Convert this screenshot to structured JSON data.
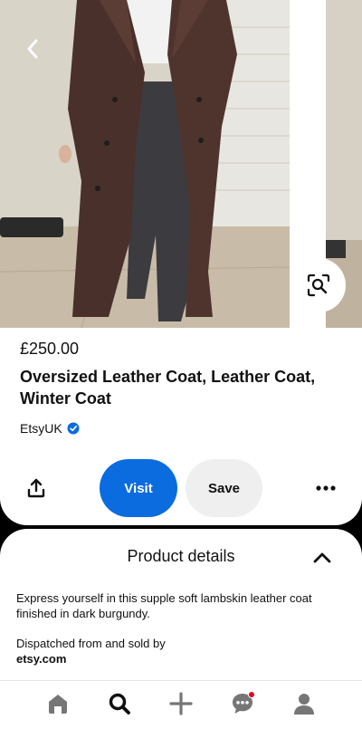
{
  "product": {
    "price": "£250.00",
    "title": "Oversized Leather Coat, Leather Coat, Winter Coat",
    "seller": "EtsyUK",
    "image_alt": "Woman wearing oversized dark burgundy leather coat over black jeans"
  },
  "actions": {
    "visit_label": "Visit",
    "save_label": "Save"
  },
  "details": {
    "title": "Product details",
    "description": "Express yourself in this supple soft lambskin leather coat finished in dark burgundy.",
    "dispatch_text": "Dispatched from and sold by",
    "dispatch_site": "etsy.com"
  },
  "icons": {
    "back": "chevron-left-icon",
    "visual_search": "lens-icon",
    "verified": "verified-check-icon",
    "share": "share-icon",
    "more": "ellipsis-icon",
    "collapse": "chevron-up-icon",
    "nav": [
      "home-icon",
      "search-icon",
      "plus-icon",
      "messages-icon",
      "profile-icon"
    ]
  },
  "colors": {
    "visit_button": "#0a6cdf",
    "save_button": "#efefef",
    "verified_badge": "#0a6cdf",
    "notification_dot": "#e60023"
  },
  "notifications": {
    "messages_unread": true
  }
}
